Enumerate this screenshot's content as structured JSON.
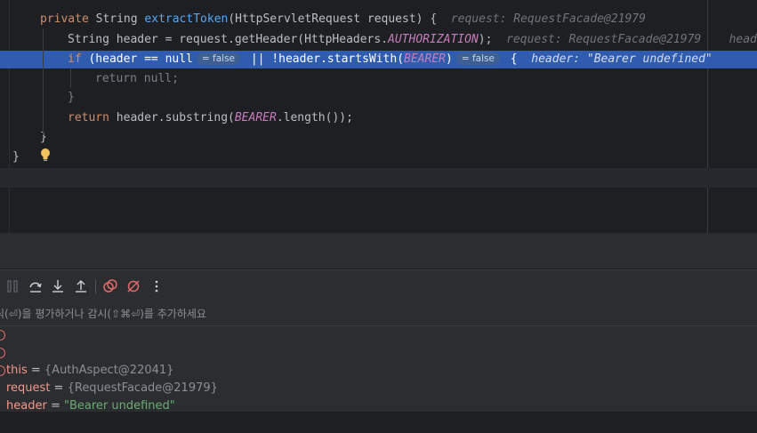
{
  "editor": {
    "lines": [
      {
        "kw1": "private",
        "type": " String ",
        "fn": "extractToken",
        "params": "(HttpServletRequest request) {",
        "hint": "request: RequestFacade@21979"
      },
      {
        "head": "String header = request.getHeader(HttpHeaders.",
        "const": "AUTHORIZATION",
        "tail": ");",
        "hint1": "request: RequestFacade@21979",
        "hint2": "head"
      },
      {
        "kw": "if",
        "part1": " (header == null",
        "chip1": "= false",
        "part2": " || !header.startsWith(",
        "const": "BEARER",
        "part3": ")",
        "chip2": "= false",
        "part4": " {",
        "hint": "header: \"Bearer undefined\""
      },
      {
        "kw": "return",
        "tail": " null;"
      },
      {
        "text": "}"
      },
      {
        "kw": "return",
        "head": " header.substring(",
        "const": "BEARER",
        "tail": ".length());"
      },
      {
        "text": "}"
      },
      {
        "text": "}"
      }
    ]
  },
  "debugger": {
    "eval_placeholder": "식(⏎)을 평가하거나 감시(⇧⌘⏎)를 추가하세요",
    "variables": [
      {
        "name": "this",
        "value": "{AuthAspect@22041}"
      },
      {
        "name": "request",
        "value": "{RequestFacade@21979}"
      },
      {
        "name": "header",
        "value": "\"Bearer undefined\""
      }
    ]
  },
  "colors": {
    "background": "#1e1f22",
    "highlight": "#2f5cae",
    "keyword": "#cf8e6d",
    "function": "#56a8f5",
    "constant": "#c77dbb",
    "string": "#6aab73"
  }
}
